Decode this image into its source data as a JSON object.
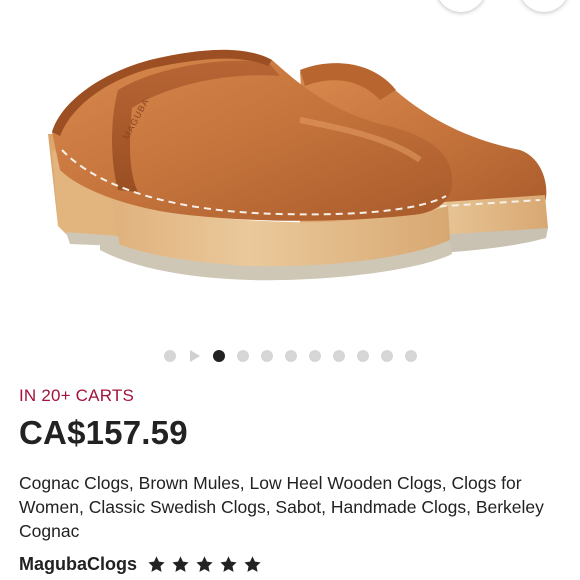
{
  "colors": {
    "accent": "#a3133b",
    "text": "#222222",
    "dot_inactive": "#d6d6d6",
    "dot_active": "#222222",
    "leather": "#c5743c",
    "wood": "#e6c190"
  },
  "image": {
    "brand_emboss": "MAGUBA"
  },
  "carousel": {
    "slides_total": 10,
    "active_slide": 2,
    "has_video": true
  },
  "listing": {
    "carts_label": "IN 20+ CARTS",
    "price": "CA$157.59",
    "title": "Cognac Clogs, Brown Mules, Low Heel Wooden Clogs, Clogs for Women, Classic Swedish Clogs, Sabot, Handmade Clogs, Berkeley Cognac",
    "shop_name": "MagubaClogs",
    "rating": 5,
    "rating_max": 5
  },
  "icons": [
    "favorite-button-icon",
    "share-button-icon",
    "video-play-icon",
    "star-icon"
  ]
}
